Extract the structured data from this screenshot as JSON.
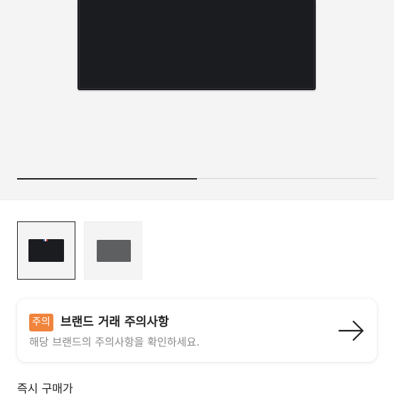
{
  "carousel": {
    "progress_fraction": 0.5
  },
  "thumbnails": [
    {
      "color_name": "black",
      "color": "#1b1c1f",
      "selected": true
    },
    {
      "color_name": "dark-grey",
      "color": "#5e5f61",
      "selected": false
    }
  ],
  "notice": {
    "badge": "주의",
    "title": "브랜드 거래 주의사항",
    "description": "해당 브랜드의 주의사항을 확인하세요.",
    "badge_color": "#f0843c",
    "icon": "arrow-right-icon"
  },
  "section": {
    "title": "즉시 구매가"
  }
}
